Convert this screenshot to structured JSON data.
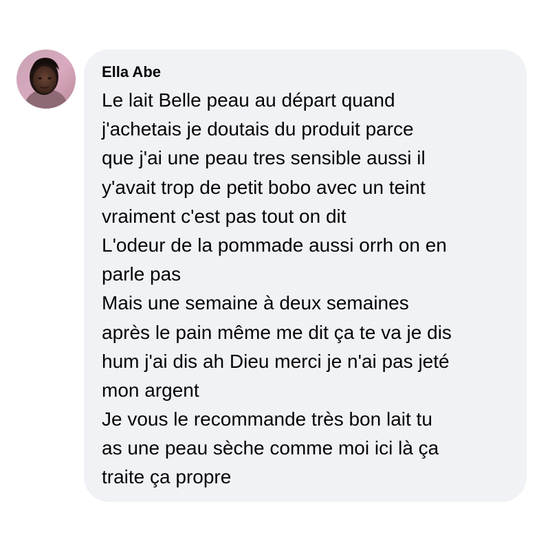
{
  "comment": {
    "author": "Ella Abe",
    "lines": [
      "Le lait Belle peau au départ quand",
      "j'achetais je doutais du produit parce",
      "que j'ai une peau tres sensible aussi il",
      "y'avait trop de petit bobo avec un teint",
      "vraiment c'est pas tout on dit",
      "L'odeur de la pommade aussi orrh on en",
      "parle pas",
      "Mais une semaine à deux semaines",
      "après le pain même me dit ça te va je dis",
      "hum j'ai dis ah Dieu merci je n'ai pas jeté",
      "mon argent",
      "Je vous le recommande très bon lait tu",
      "as une peau sèche comme moi ici là ça",
      "traite ça propre"
    ]
  },
  "colors": {
    "bubble": "#f0f2f5",
    "text": "#050505"
  },
  "icons": {
    "avatar": "user-profile-photo"
  }
}
